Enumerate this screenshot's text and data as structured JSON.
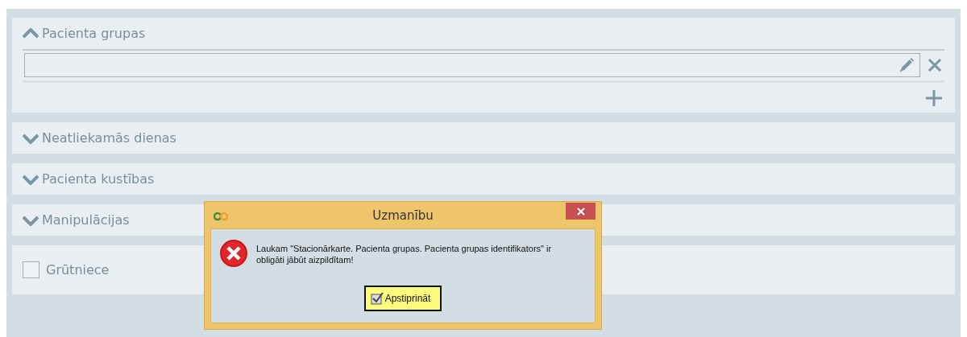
{
  "sections": [
    {
      "title": "Pacienta grupas",
      "expanded": true,
      "rows": [
        {
          "value": ""
        }
      ]
    },
    {
      "title": "Neatliekamās dienas",
      "expanded": false
    },
    {
      "title": "Pacienta kustības",
      "expanded": false
    },
    {
      "title": "Manipulācijas",
      "expanded": false
    }
  ],
  "checkbox": {
    "label": "Grūtniece",
    "checked": false
  },
  "dialog": {
    "title": "Uzmanību",
    "message": "Laukam \"Stacionārkarte. Pacienta grupas. Pacienta grupas identifikators\" ir obligāti jābūt aizpildītam!",
    "button": "Apstiprināt"
  }
}
